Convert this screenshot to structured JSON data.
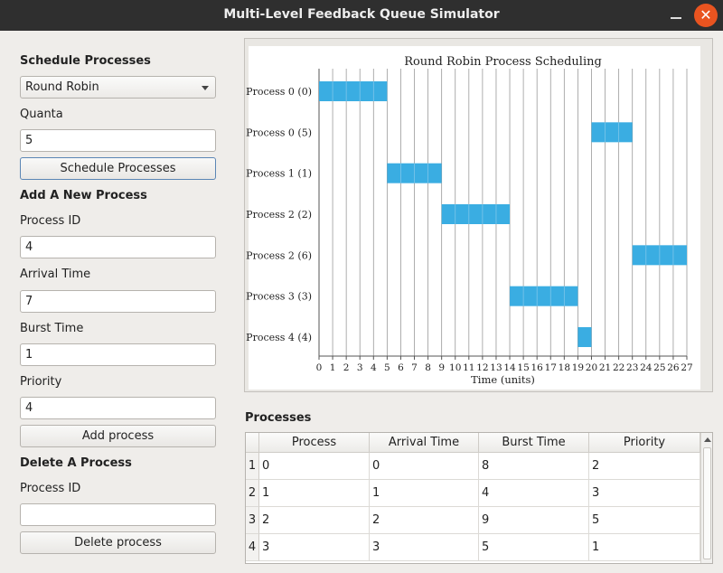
{
  "window": {
    "title": "Multi-Level Feedback Queue Simulator",
    "close_glyph": "✕"
  },
  "schedule": {
    "header": "Schedule Processes",
    "algorithm": "Round Robin",
    "quanta_label": "Quanta",
    "quanta_value": "5",
    "button": "Schedule Processes"
  },
  "add": {
    "header": "Add A New Process",
    "pid_label": "Process ID",
    "pid_value": "4",
    "arrival_label": "Arrival Time",
    "arrival_value": "7",
    "burst_label": "Burst Time",
    "burst_value": "1",
    "priority_label": "Priority",
    "priority_value": "4",
    "button": "Add process"
  },
  "delete": {
    "header": "Delete A Process",
    "pid_label": "Process ID",
    "pid_value": "",
    "button": "Delete process"
  },
  "chart_data": {
    "type": "gantt",
    "title": "Round Robin Process Scheduling",
    "xlabel": "Time (units)",
    "xlim": [
      0,
      27
    ],
    "xticks": [
      0,
      1,
      2,
      3,
      4,
      5,
      6,
      7,
      8,
      9,
      10,
      11,
      12,
      13,
      14,
      15,
      16,
      17,
      18,
      19,
      20,
      21,
      22,
      23,
      24,
      25,
      26,
      27
    ],
    "grid": true,
    "bar_color": "#3aade2",
    "rows": [
      {
        "label": "Process 0 (0)",
        "start": 0,
        "end": 5
      },
      {
        "label": "Process 0 (5)",
        "start": 20,
        "end": 23
      },
      {
        "label": "Process 1 (1)",
        "start": 5,
        "end": 9
      },
      {
        "label": "Process 2 (2)",
        "start": 9,
        "end": 14
      },
      {
        "label": "Process 2 (6)",
        "start": 23,
        "end": 27
      },
      {
        "label": "Process 3 (3)",
        "start": 14,
        "end": 19
      },
      {
        "label": "Process 4 (4)",
        "start": 19,
        "end": 20
      }
    ]
  },
  "processes": {
    "title": "Processes",
    "columns": [
      "Process",
      "Arrival Time",
      "Burst Time",
      "Priority"
    ],
    "rows": [
      {
        "num": "1",
        "cells": [
          "0",
          "0",
          "8",
          "2"
        ]
      },
      {
        "num": "2",
        "cells": [
          "1",
          "1",
          "4",
          "3"
        ]
      },
      {
        "num": "3",
        "cells": [
          "2",
          "2",
          "9",
          "5"
        ]
      },
      {
        "num": "4",
        "cells": [
          "3",
          "3",
          "5",
          "1"
        ]
      }
    ]
  }
}
